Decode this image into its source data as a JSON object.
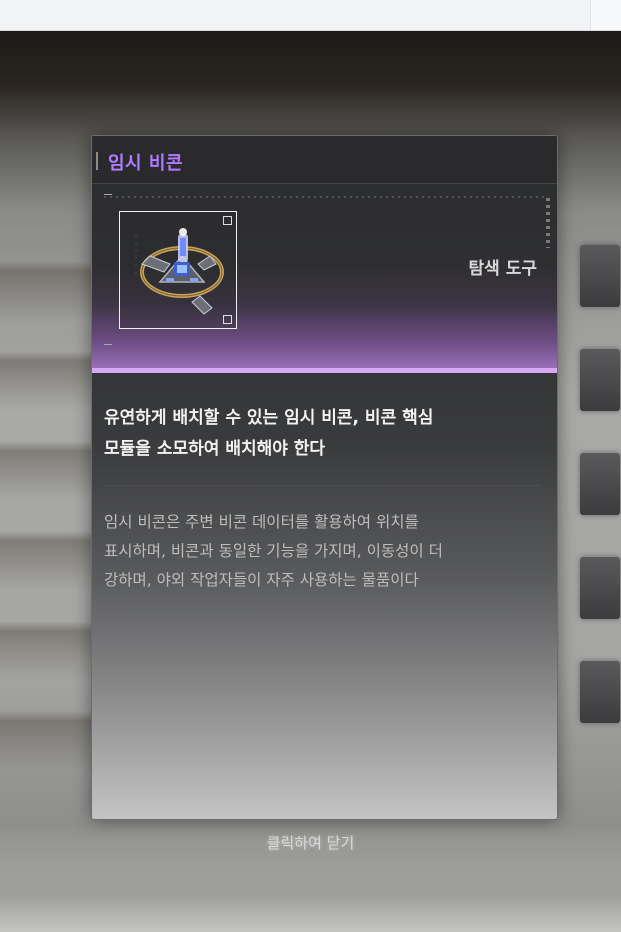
{
  "item": {
    "name": "임시 비콘",
    "category": "탐색 도구",
    "summary_line1": "유연하게 배치할 수 있는 임시 비콘, 비콘 핵심",
    "summary_line2": "모듈을 소모하여 배치해야 한다",
    "desc_line1": "임시 비콘은 주변 비콘 데이터를 활용하여 위치를",
    "desc_line2": "표시하며, 비콘과 동일한 기능을 가지며, 이동성이 더",
    "desc_line3": "강하며, 야외 작업자들이 자주 사용하는 물품이다",
    "icon": "beacon-icon"
  },
  "footer": {
    "close_hint": "클릭하여 닫기"
  },
  "colors": {
    "name_accent": "#b17bff",
    "rarity_band": "#d7a9f4"
  }
}
